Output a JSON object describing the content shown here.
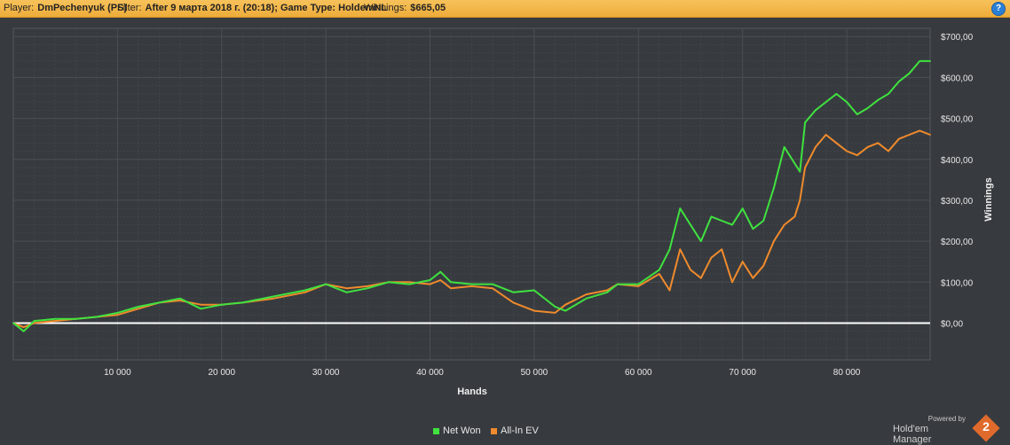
{
  "header": {
    "player_label": "Player:",
    "player_value": "DmPechenyuk (PS)",
    "filter_label": "Filter:",
    "filter_value": "After 9 марта 2018 г. (20:18); Game Type: HoldemNL",
    "winnings_label": "Winnings:",
    "winnings_value": "$665,05",
    "help_glyph": "?"
  },
  "colors": {
    "net_won": "#3fe23f",
    "all_in_ev": "#f08a2c",
    "zero_line": "#ffffff",
    "background": "#373b3f",
    "grid": "#4a4f54"
  },
  "chart_data": {
    "type": "line",
    "xlabel": "Hands",
    "ylabel": "Winnings",
    "xlim": [
      0,
      88000
    ],
    "ylim": [
      -90,
      720
    ],
    "x_ticks": [
      10000,
      20000,
      30000,
      40000,
      50000,
      60000,
      70000,
      80000
    ],
    "x_tick_labels": [
      "10 000",
      "20 000",
      "30 000",
      "40 000",
      "50 000",
      "60 000",
      "70 000",
      "80 000"
    ],
    "y_ticks": [
      0,
      100,
      200,
      300,
      400,
      500,
      600,
      700
    ],
    "y_tick_labels": [
      "$0,00",
      "$100,00",
      "$200,00",
      "$300,00",
      "$400,00",
      "$500,00",
      "$600,00",
      "$700,00"
    ],
    "grid": true,
    "legend_position": "bottom",
    "series": [
      {
        "name": "Net Won",
        "x": [
          0,
          1000,
          2000,
          4000,
          6000,
          8000,
          10000,
          12000,
          14000,
          16000,
          18000,
          20000,
          22000,
          25000,
          28000,
          30000,
          32000,
          34000,
          36000,
          38000,
          40000,
          41000,
          42000,
          44000,
          46000,
          48000,
          50000,
          52000,
          53000,
          55000,
          57000,
          58000,
          60000,
          62000,
          63000,
          64000,
          65000,
          66000,
          67000,
          68000,
          69000,
          70000,
          71000,
          72000,
          73000,
          74000,
          75000,
          75500,
          76000,
          77000,
          78000,
          79000,
          80000,
          81000,
          82000,
          83000,
          84000,
          85000,
          86000,
          87000,
          88000
        ],
        "y": [
          0,
          -20,
          5,
          10,
          10,
          15,
          25,
          40,
          50,
          60,
          35,
          45,
          50,
          65,
          80,
          95,
          75,
          85,
          100,
          95,
          105,
          125,
          100,
          95,
          95,
          75,
          80,
          40,
          30,
          60,
          75,
          95,
          95,
          130,
          180,
          280,
          240,
          200,
          260,
          250,
          240,
          280,
          230,
          250,
          330,
          430,
          390,
          370,
          490,
          520,
          540,
          560,
          540,
          510,
          525,
          545,
          560,
          590,
          610,
          640,
          640
        ]
      },
      {
        "name": "All-In EV",
        "x": [
          0,
          1000,
          2000,
          4000,
          6000,
          8000,
          10000,
          12000,
          14000,
          16000,
          18000,
          20000,
          22000,
          25000,
          28000,
          30000,
          32000,
          34000,
          36000,
          38000,
          40000,
          41000,
          42000,
          44000,
          46000,
          48000,
          50000,
          52000,
          53000,
          55000,
          57000,
          58000,
          60000,
          62000,
          63000,
          64000,
          65000,
          66000,
          67000,
          68000,
          69000,
          70000,
          71000,
          72000,
          73000,
          74000,
          75000,
          75500,
          76000,
          77000,
          78000,
          79000,
          80000,
          81000,
          82000,
          83000,
          84000,
          85000,
          86000,
          87000,
          88000
        ],
        "y": [
          0,
          -10,
          0,
          5,
          10,
          15,
          20,
          35,
          50,
          55,
          45,
          45,
          50,
          60,
          75,
          95,
          85,
          90,
          100,
          100,
          95,
          105,
          85,
          90,
          85,
          50,
          30,
          25,
          45,
          70,
          80,
          95,
          90,
          120,
          80,
          180,
          130,
          110,
          160,
          180,
          100,
          150,
          110,
          140,
          200,
          240,
          260,
          300,
          380,
          430,
          460,
          440,
          420,
          410,
          430,
          440,
          420,
          450,
          460,
          470,
          460
        ]
      }
    ]
  },
  "legend": [
    {
      "label": "Net Won"
    },
    {
      "label": "All-In EV"
    }
  ],
  "branding": {
    "powered_by": "Powered by",
    "product": "Hold'em Manager",
    "version_badge": "2"
  }
}
